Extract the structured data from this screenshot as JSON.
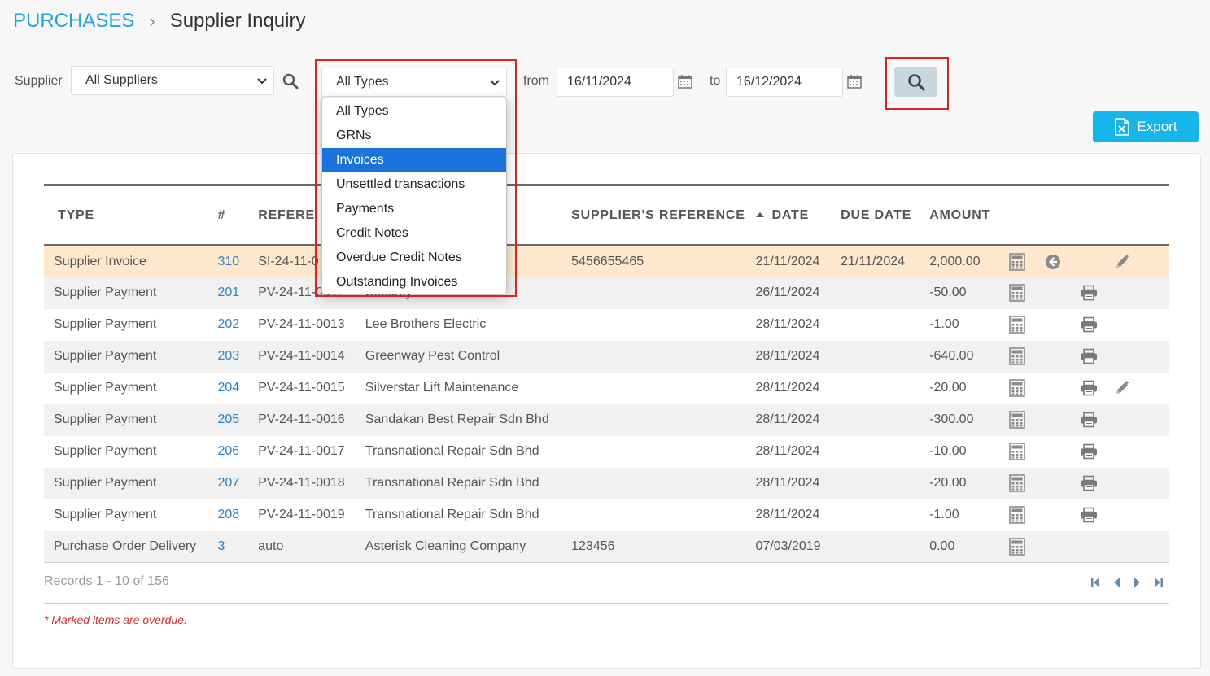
{
  "breadcrumb": {
    "root": "PURCHASES",
    "current": "Supplier Inquiry"
  },
  "filters": {
    "supplier_label": "Supplier",
    "supplier_value": "All Suppliers",
    "type_value": "All Types",
    "type_options": [
      "All Types",
      "GRNs",
      "Invoices",
      "Unsettled transactions",
      "Payments",
      "Credit Notes",
      "Overdue Credit Notes",
      "Outstanding Invoices"
    ],
    "type_highlighted": "Invoices",
    "from_label": "from",
    "from_value": "16/11/2024",
    "to_label": "to",
    "to_value": "16/12/2024"
  },
  "export_label": "Export",
  "table": {
    "headers": {
      "type": "TYPE",
      "num": "#",
      "reference": "REFERE",
      "supplier_ref": "SUPPLIER'S REFERENCE",
      "date": "DATE",
      "due_date": "DUE DATE",
      "amount": "AMOUNT"
    },
    "rows": [
      {
        "type": "Supplier Invoice",
        "num": "310",
        "ref": "SI-24-11-0",
        "name": "s",
        "sref": "5456655465",
        "date": "21/11/2024",
        "due": "21/11/2024",
        "amount": "2,000.00",
        "icons": [
          "calc",
          "back",
          "",
          "edit"
        ],
        "style": "highlight"
      },
      {
        "type": "Supplier Payment",
        "num": "201",
        "ref": "PV-24-11-0012",
        "name": "Security",
        "sref": "",
        "date": "26/11/2024",
        "due": "",
        "amount": "-50.00",
        "icons": [
          "calc",
          "",
          "print",
          ""
        ],
        "style": "odd"
      },
      {
        "type": "Supplier Payment",
        "num": "202",
        "ref": "PV-24-11-0013",
        "name": "Lee Brothers Electric",
        "sref": "",
        "date": "28/11/2024",
        "due": "",
        "amount": "-1.00",
        "icons": [
          "calc",
          "",
          "print",
          ""
        ],
        "style": "even"
      },
      {
        "type": "Supplier Payment",
        "num": "203",
        "ref": "PV-24-11-0014",
        "name": "Greenway Pest Control",
        "sref": "",
        "date": "28/11/2024",
        "due": "",
        "amount": "-640.00",
        "icons": [
          "calc",
          "",
          "print",
          ""
        ],
        "style": "odd"
      },
      {
        "type": "Supplier Payment",
        "num": "204",
        "ref": "PV-24-11-0015",
        "name": "Silverstar Lift Maintenance",
        "sref": "",
        "date": "28/11/2024",
        "due": "",
        "amount": "-20.00",
        "icons": [
          "calc",
          "",
          "print",
          "edit"
        ],
        "style": "even"
      },
      {
        "type": "Supplier Payment",
        "num": "205",
        "ref": "PV-24-11-0016",
        "name": "Sandakan Best Repair Sdn Bhd",
        "sref": "",
        "date": "28/11/2024",
        "due": "",
        "amount": "-300.00",
        "icons": [
          "calc",
          "",
          "print",
          ""
        ],
        "style": "odd"
      },
      {
        "type": "Supplier Payment",
        "num": "206",
        "ref": "PV-24-11-0017",
        "name": "Transnational Repair Sdn Bhd",
        "sref": "",
        "date": "28/11/2024",
        "due": "",
        "amount": "-10.00",
        "icons": [
          "calc",
          "",
          "print",
          ""
        ],
        "style": "even"
      },
      {
        "type": "Supplier Payment",
        "num": "207",
        "ref": "PV-24-11-0018",
        "name": "Transnational Repair Sdn Bhd",
        "sref": "",
        "date": "28/11/2024",
        "due": "",
        "amount": "-20.00",
        "icons": [
          "calc",
          "",
          "print",
          ""
        ],
        "style": "odd"
      },
      {
        "type": "Supplier Payment",
        "num": "208",
        "ref": "PV-24-11-0019",
        "name": "Transnational Repair Sdn Bhd",
        "sref": "",
        "date": "28/11/2024",
        "due": "",
        "amount": "-1.00",
        "icons": [
          "calc",
          "",
          "print",
          ""
        ],
        "style": "even"
      },
      {
        "type": "Purchase Order Delivery",
        "num": "3",
        "ref": "auto",
        "name": "Asterisk Cleaning Company",
        "sref": "123456",
        "date": "07/03/2019",
        "due": "",
        "amount": "0.00",
        "icons": [
          "calc",
          "",
          "",
          ""
        ],
        "style": "odd"
      }
    ]
  },
  "records_text": "Records 1 - 10 of 156",
  "overdue_note": "* Marked items are overdue.",
  "colors": {
    "accent": "#27a2d8",
    "export": "#16b5ea",
    "highlight_row": "#fde8cd",
    "selected_option": "#1a73d9",
    "annotation": "#e02020"
  }
}
